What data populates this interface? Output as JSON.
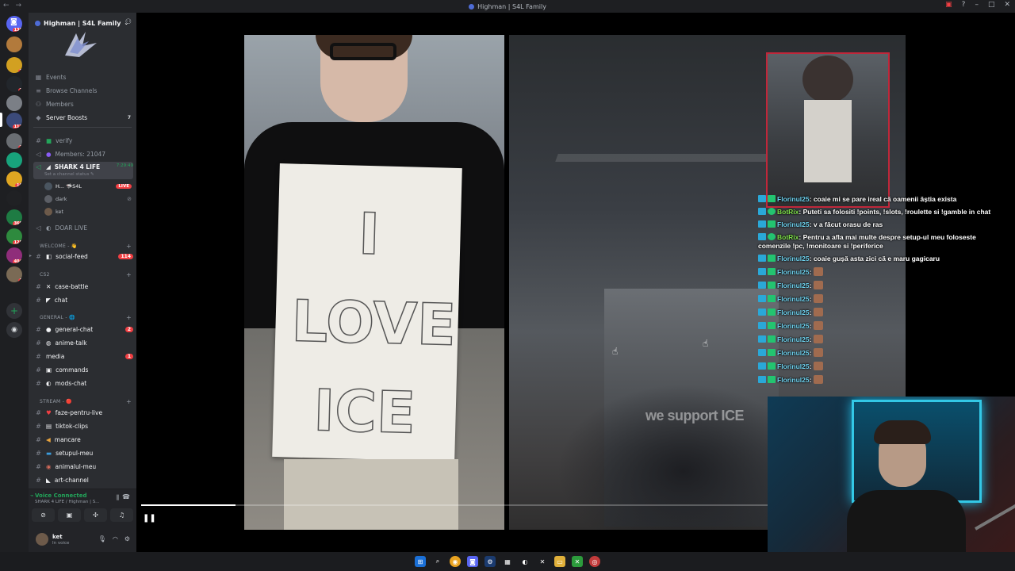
{
  "window": {
    "title": "Highman | S4L Family"
  },
  "server_rail": {
    "badges": [
      "130",
      "2",
      "3",
      "117",
      "2",
      "1",
      "10",
      "369",
      "128",
      "404",
      "1"
    ]
  },
  "server": {
    "name": "Highman | S4L Family",
    "menu": {
      "events": "Events",
      "browse": "Browse Channels",
      "members": "Members",
      "boosts": "Server Boosts",
      "boosts_count": "7"
    },
    "channels_top": {
      "verify": "verify",
      "members_count": "Members: 21047",
      "shark": "SHARK 4 LIFE",
      "shark_timer": "7:29:49",
      "shark_status": "Set a channel status",
      "doar_live": "DOAR LIVE"
    },
    "voice_users": [
      {
        "name": "H... 🦈S4L",
        "live": "LIVE"
      },
      {
        "name": "dark"
      },
      {
        "name": "ket"
      }
    ],
    "categories": {
      "welcome": "WELCOME - 👋",
      "cs2": "CS2",
      "general": "GENERAL - 🌐",
      "stream": "STREAM - 🔴"
    },
    "channels": {
      "social_feed": "social-feed",
      "social_feed_count": "114",
      "case_battle": "case-battle",
      "chat": "chat",
      "general_chat": "general-chat",
      "general_chat_count": "2",
      "anime_talk": "anime-talk",
      "media": "media",
      "media_count": "1",
      "commands": "commands",
      "mods_chat": "mods-chat",
      "faze": "faze-pentru-live",
      "tiktok": "tiktok-clips",
      "mancare": "mancare",
      "setupul": "setupul-meu",
      "animalul": "animalul-meu",
      "art": "art-channel"
    }
  },
  "voice_panel": {
    "status": "Voice Connected",
    "location": "SHARK 4 LIFE / Highman | S..."
  },
  "user": {
    "name": "ket",
    "status": "In voice"
  },
  "stream": {
    "caption": "we support ICE",
    "progress": 0.15
  },
  "chat": [
    {
      "user": "Florinul25",
      "text": "coaie mi se pare ireal că oamenii ăștia exista",
      "bot": false
    },
    {
      "user": "BotRix",
      "text": "Puteti sa folositi !points, !slots, !roulette si !gamble in chat",
      "bot": true
    },
    {
      "user": "Florinul25",
      "text": "v a făcut orasu de ras",
      "bot": false
    },
    {
      "user": "BotRix",
      "text": "Pentru a afla mai multe despre setup-ul meu foloseste comenzile !pc, !monitoare si !periferice",
      "bot": true
    },
    {
      "user": "Florinul25",
      "text": "coaie gușă asta zici că e maru gagicaru",
      "bot": false
    },
    {
      "user": "Florinul25",
      "text": "",
      "bot": false,
      "emote": true
    },
    {
      "user": "Florinul25",
      "text": "",
      "bot": false,
      "emote": true
    },
    {
      "user": "Florinul25",
      "text": "",
      "bot": false,
      "emote": true
    },
    {
      "user": "Florinul25",
      "text": "",
      "bot": false,
      "emote": true
    },
    {
      "user": "Florinul25",
      "text": "",
      "bot": false,
      "emote": true
    },
    {
      "user": "Florinul25",
      "text": "",
      "bot": false,
      "emote": true
    },
    {
      "user": "Florinul25",
      "text": "",
      "bot": false,
      "emote": true
    },
    {
      "user": "Florinul25",
      "text": "",
      "bot": false,
      "emote": true
    },
    {
      "user": "Florinul25",
      "text": "",
      "bot": false,
      "emote": true
    }
  ],
  "colors": {
    "accent_live": "#f23f43",
    "voice_green": "#23a55a",
    "webcam_glow": "#33c8e6",
    "pip_border": "#c0273a"
  }
}
